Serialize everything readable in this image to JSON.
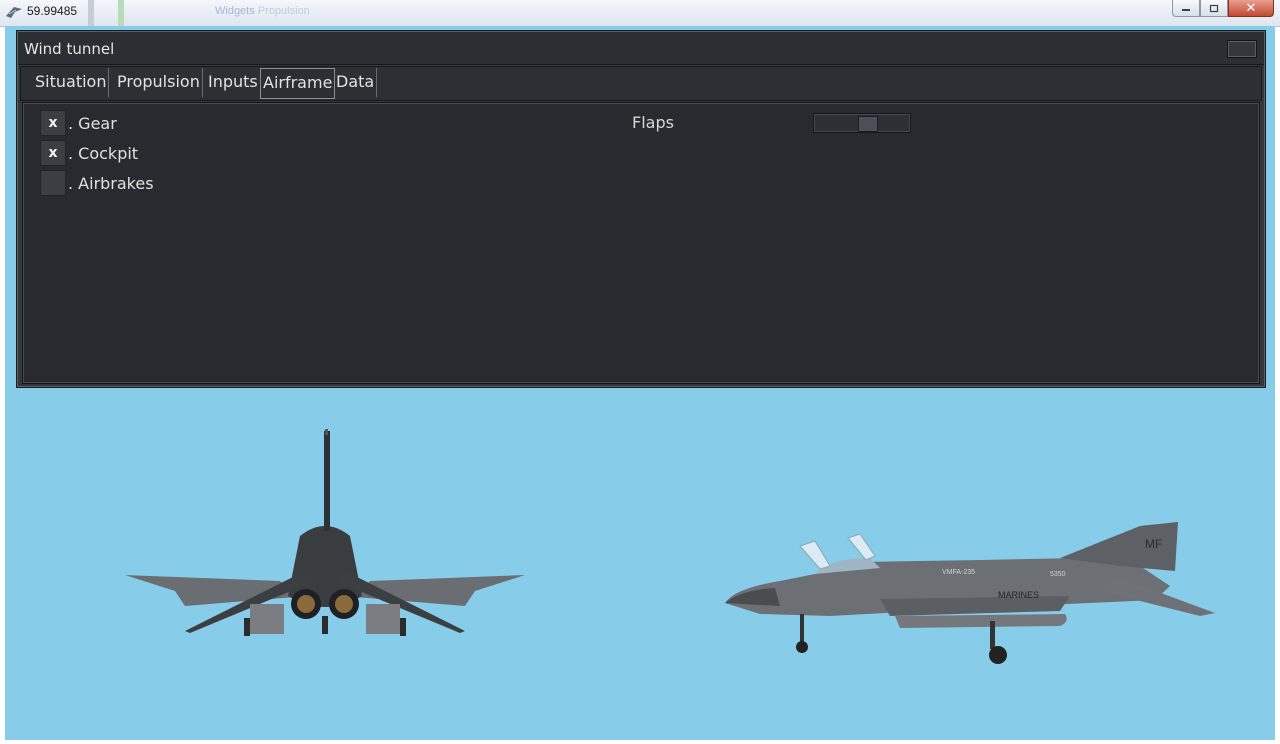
{
  "window": {
    "title": "59.99485",
    "background_title": "Propulsion"
  },
  "panel": {
    "title": "Wind tunnel",
    "tabs": [
      {
        "label": "Situation",
        "active": false
      },
      {
        "label": "Propulsion",
        "active": false
      },
      {
        "label": "Inputs",
        "active": false
      },
      {
        "label": "Airframe",
        "active": true
      },
      {
        "label": "Data",
        "active": false
      }
    ],
    "airframe": {
      "checkboxes": [
        {
          "label": ". Gear",
          "checked": true,
          "mark": "x"
        },
        {
          "label": ". Cockpit",
          "checked": true,
          "mark": "x"
        },
        {
          "label": ". Airbrakes",
          "checked": false,
          "mark": ""
        }
      ],
      "flaps_label": "Flaps",
      "flaps_value": 0.58
    }
  },
  "scene": {
    "sky_color": "#87cdea",
    "aircraft_markings": {
      "squadron": "VMFA-235",
      "serial": "5350",
      "service": "MARINES",
      "tail_code": "MF"
    }
  },
  "colors": {
    "panel_bg": "#34373c",
    "panel_content": "#272a2e",
    "text": "#e1e1e1"
  },
  "icons": [
    "app-icon",
    "minimize-icon",
    "maximize-icon",
    "close-icon",
    "checkbox-check-icon"
  ]
}
